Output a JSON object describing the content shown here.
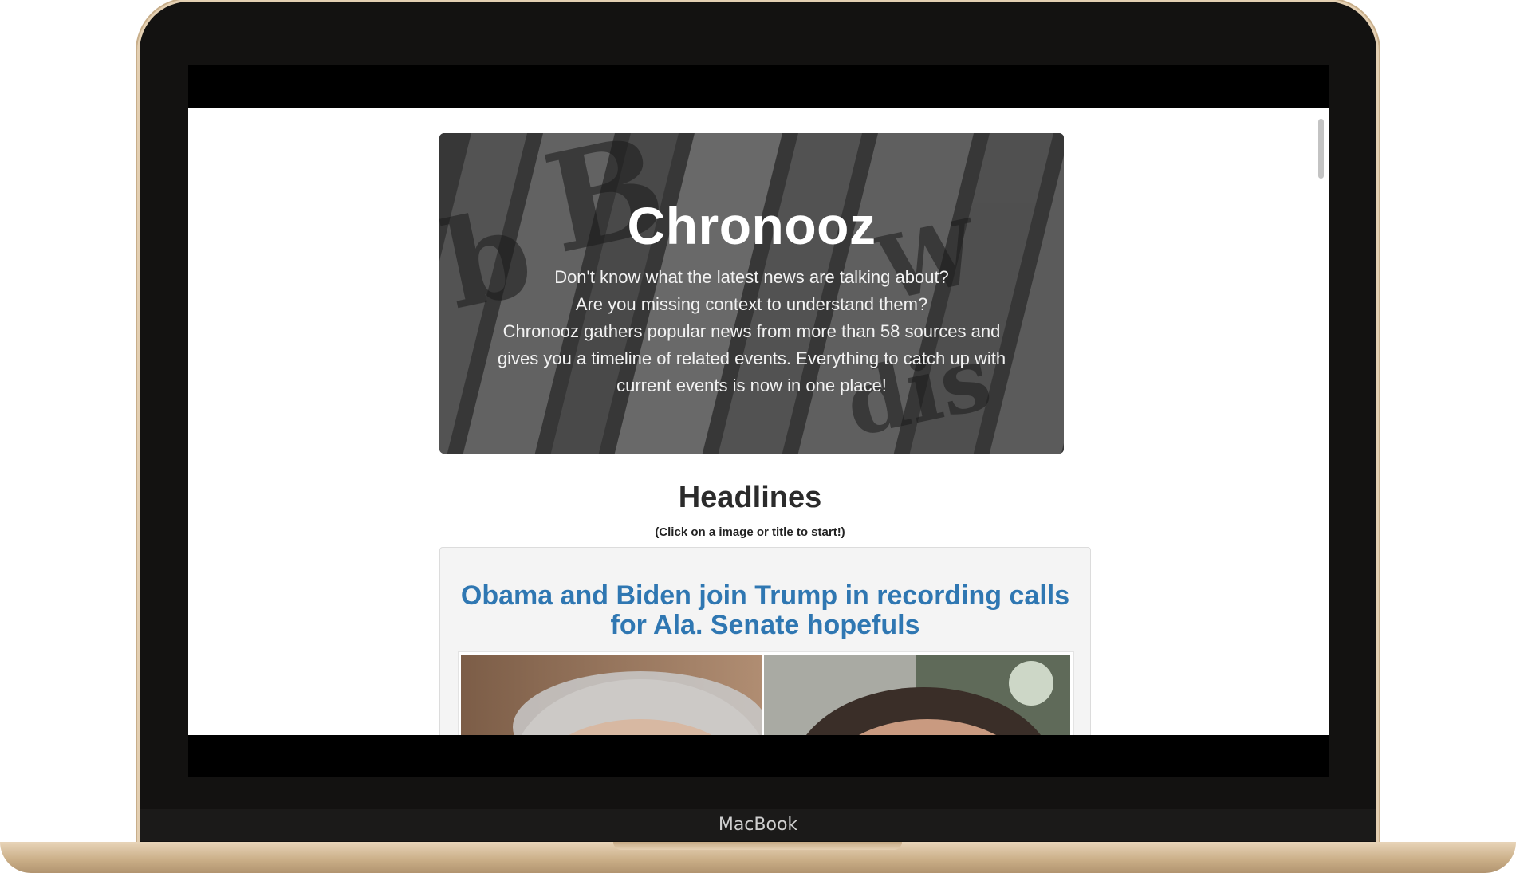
{
  "device": {
    "brand": "MacBook"
  },
  "hero": {
    "title": "Chronooz",
    "lines": [
      "Don't know what the latest news are talking about?",
      "Are you missing context to understand them?",
      "Chronooz gathers popular news from more than 58 sources and",
      "gives you a timeline of related events. Everything to catch up with",
      "current events is now in one place!"
    ]
  },
  "headlines": {
    "heading": "Headlines",
    "hint": "(Click on a image or title to start!)"
  },
  "article": {
    "title": "Obama and Biden join Trump in recording calls for Ala. Senate hopefuls"
  },
  "colors": {
    "link": "#2f77b2",
    "bezel": "#131211",
    "gold": "#e3cfb2"
  }
}
